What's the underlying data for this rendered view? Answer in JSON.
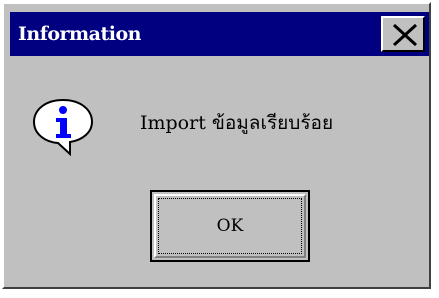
{
  "dialog": {
    "title": "Information",
    "message": "Import ข้อมูลเรียบร้อย",
    "ok_label": "OK",
    "icon": "info-icon",
    "close_icon": "close-icon"
  },
  "colors": {
    "titlebar": "#000080",
    "face": "#c0c0c0",
    "title_text": "#ffffff",
    "icon_blue": "#0000ff"
  }
}
